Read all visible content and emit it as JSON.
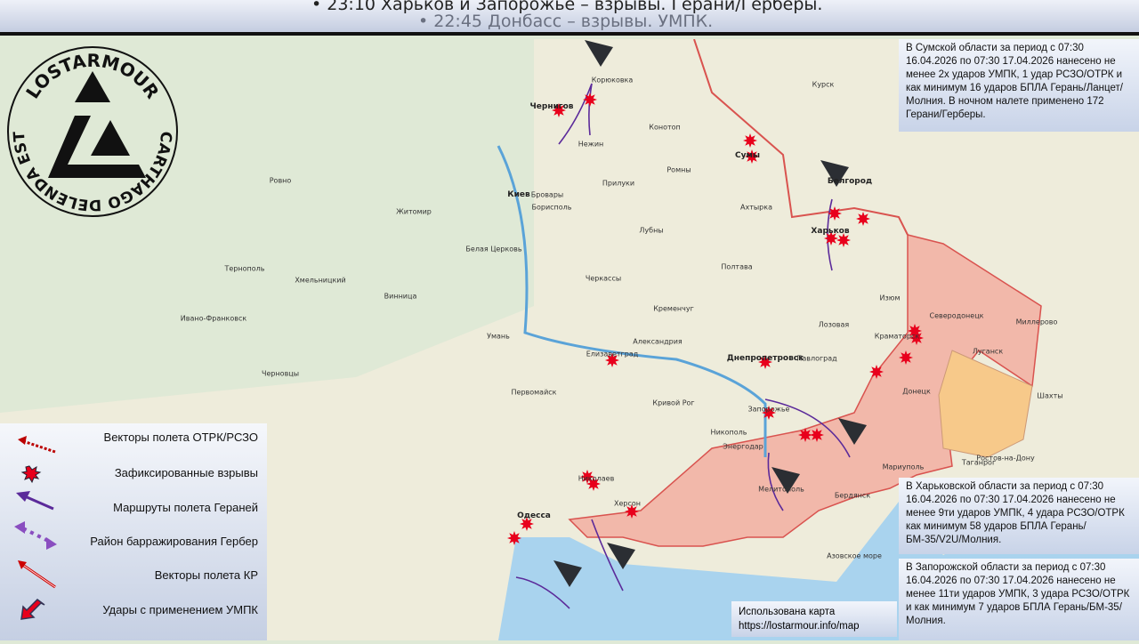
{
  "banner": {
    "line1": "• 23:10 Харьков и Запорожье – взрывы. Герани/Герберы.",
    "line2": "• 22:45 Донбасс – взрывы. УМПК."
  },
  "logo": {
    "top_text": "LOSTARMOUR",
    "bottom_text": "CARTHAGO DELENDA EST"
  },
  "info_boxes": [
    {
      "region": "sumy",
      "text": "В Сумской области за период с 07:30 16.04.2026 по 07:30 17.04.2026 нанесено не менее 2х ударов УМПК, 1 удар РСЗО/ОТРК и как минимум 16 ударов БПЛА Герань/Ланцет/Молния. В ночном налете применено 172 Герани/Герберы."
    },
    {
      "region": "kharkov",
      "text": "В Харьковской области за период с 07:30 16.04.2026 по 07:30 17.04.2026 нанесено не менее 9ти ударов УМПК, 4 удара РСЗО/ОТРК как минимум 58 ударов БПЛА Герань/БМ-35/V2U/Молния."
    },
    {
      "region": "zaporozhye",
      "text": "В Запорожской области за период с 07:30 16.04.2026 по 07:30 17.04.2026 нанесено не менее 11ти ударов УМПК, 3 удара РСЗО/ОТРК и как минимум 7 ударов БПЛА Герань/БМ-35/Молния."
    }
  ],
  "legend": [
    {
      "icon": "dotted-red-arrow-icon",
      "label": "Векторы полета ОТРК/РСЗО"
    },
    {
      "icon": "explosion-icon",
      "label": "Зафиксированные взрывы"
    },
    {
      "icon": "purple-arrow-icon",
      "label": "Маршруты полета Гераней"
    },
    {
      "icon": "dotted-purple-double-arrow-icon",
      "label": "Район барражирования Гербер"
    },
    {
      "icon": "red-outline-arrow-icon",
      "label": "Векторы полета КР"
    },
    {
      "icon": "red-block-arrow-icon",
      "label": "Удары с применением УМПК"
    }
  ],
  "credit": {
    "line1": "Использована карта",
    "line2": "https://lostarmour.info/map"
  },
  "colors": {
    "occupied": "#f2b8aa",
    "lnr": "#f7c98a",
    "sea": "#a9d3ee",
    "explosion": "#e8001c",
    "route": "#5b2a9a"
  },
  "cities": [
    "Киев",
    "Бровары",
    "Борисполь",
    "Житомир",
    "Чернигов",
    "Корюковка",
    "Нежин",
    "Конотоп",
    "Прилуки",
    "Ромны",
    "Сумы",
    "Курск",
    "Белгород",
    "Харьков",
    "Полтава",
    "Ахтырка",
    "Лубны",
    "Черкассы",
    "Белая Церковь",
    "Кременчуг",
    "Александрия",
    "Елизаветград",
    "Умань",
    "Первомайск",
    "Кривой Рог",
    "Днепропетровск",
    "Павлоград",
    "Лозовая",
    "Запорожье",
    "Никополь",
    "Энергодар",
    "Мелитополь",
    "Бердянск",
    "Мариуполь",
    "Николаев",
    "Херсон",
    "Одесса",
    "Изюм",
    "Краматорск",
    "Северодонецк",
    "Луганск",
    "Донецк",
    "Миллерово",
    "Шахты",
    "Таганрог",
    "Ростов-на-Дону",
    "Ровно",
    "Тернополь",
    "Хмельницкий",
    "Винница",
    "Ивано-Франковск",
    "Черновцы",
    "Азовское море"
  ]
}
